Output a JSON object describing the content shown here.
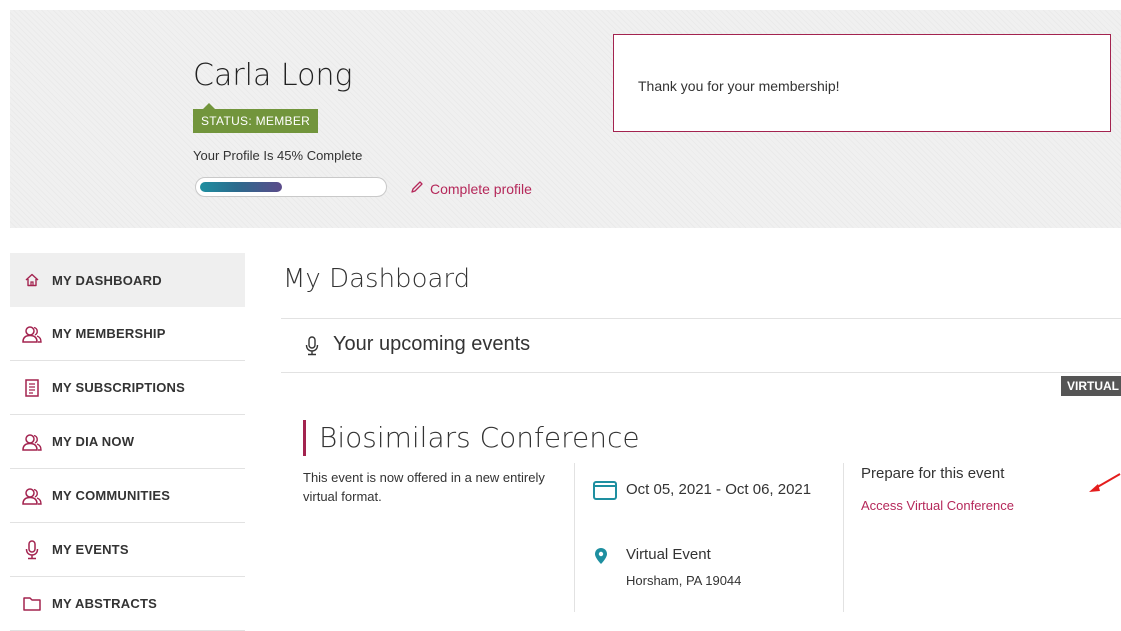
{
  "profile": {
    "name": "Carla Long",
    "status": "STATUS: MEMBER",
    "completion_text": "Your Profile Is 45% Complete",
    "completion_percent": 45,
    "complete_link": "Complete profile",
    "accent_color": "#b5285a"
  },
  "message": {
    "text": "Thank you for your membership!"
  },
  "sidebar": {
    "items": [
      {
        "label": "MY DASHBOARD",
        "icon": "home-icon",
        "active": true
      },
      {
        "label": "MY MEMBERSHIP",
        "icon": "people-icon"
      },
      {
        "label": "MY SUBSCRIPTIONS",
        "icon": "document-icon"
      },
      {
        "label": "MY DIA NOW",
        "icon": "people-icon"
      },
      {
        "label": "MY COMMUNITIES",
        "icon": "people-icon"
      },
      {
        "label": "MY EVENTS",
        "icon": "microphone-icon"
      },
      {
        "label": "MY ABSTRACTS",
        "icon": "folder-icon"
      }
    ]
  },
  "main": {
    "title": "My Dashboard",
    "upcoming_label": "Your upcoming events",
    "event": {
      "badge": "VIRTUAL",
      "title": "Biosimilars Conference",
      "description": "This event is now offered in a new entirely virtual format.",
      "date": "Oct 05, 2021 - Oct 06, 2021",
      "location_name": "Virtual Event",
      "location_address": "Horsham, PA 19044",
      "prepare_title": "Prepare for this event",
      "access_link": "Access Virtual Conference"
    }
  }
}
